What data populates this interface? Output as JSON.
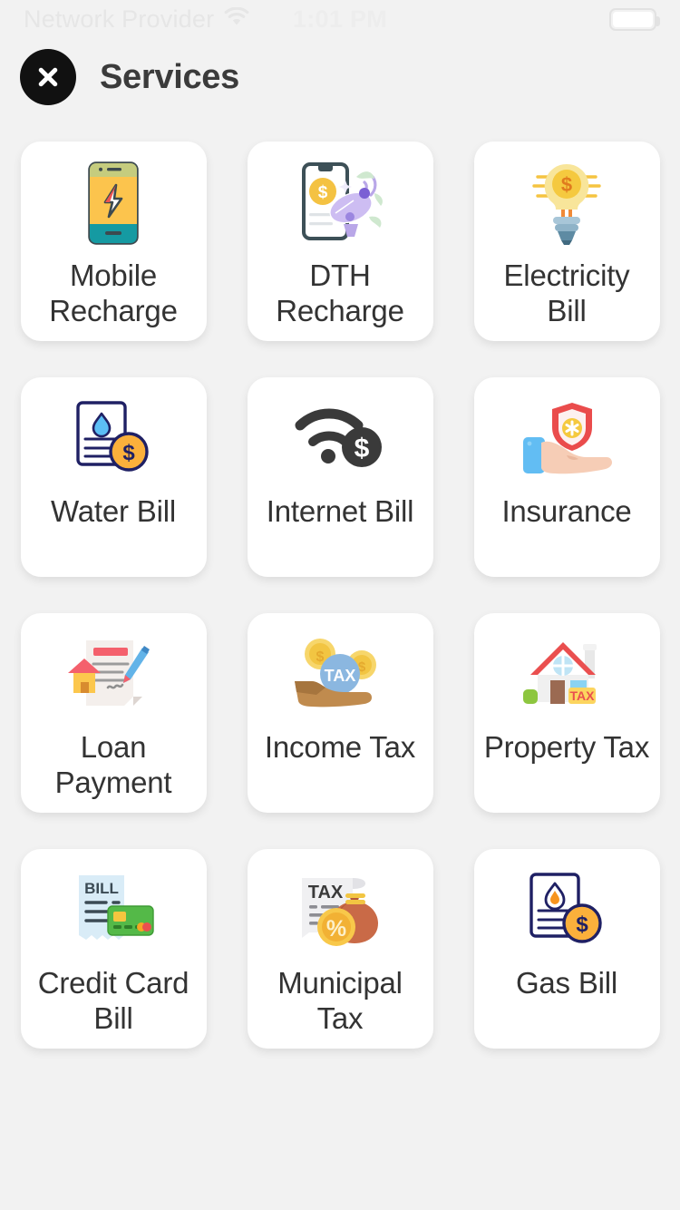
{
  "status_bar": {
    "carrier": "Network Provider",
    "wifi_icon": "wifi-icon",
    "time": "1:01 PM",
    "battery_icon": "battery-full-icon"
  },
  "header": {
    "close_label": "close-icon",
    "title": "Services"
  },
  "colors": {
    "background": "#f2f2f2",
    "card": "#ffffff",
    "title": "#3b3b3b",
    "label": "#333333",
    "close_button": "#111111"
  },
  "services": [
    {
      "label": "Mobile Recharge",
      "icon": "mobile-recharge-icon"
    },
    {
      "label": "DTH Recharge",
      "icon": "dth-recharge-icon"
    },
    {
      "label": "Electricity Bill",
      "icon": "electricity-bill-icon"
    },
    {
      "label": "Water Bill",
      "icon": "water-bill-icon"
    },
    {
      "label": "Internet Bill",
      "icon": "internet-bill-icon"
    },
    {
      "label": "Insurance",
      "icon": "insurance-icon"
    },
    {
      "label": "Loan Payment",
      "icon": "loan-payment-icon"
    },
    {
      "label": "Income Tax",
      "icon": "income-tax-icon"
    },
    {
      "label": "Property Tax",
      "icon": "property-tax-icon"
    },
    {
      "label": "Credit Card Bill",
      "icon": "credit-card-bill-icon"
    },
    {
      "label": "Municipal Tax",
      "icon": "municipal-tax-icon"
    },
    {
      "label": "Gas Bill",
      "icon": "gas-bill-icon"
    }
  ],
  "icon_text": {
    "income_tax_badge": "TAX",
    "property_tax_sign": "TAX",
    "credit_card_bill_heading": "BILL",
    "municipal_tax_heading": "TAX"
  }
}
